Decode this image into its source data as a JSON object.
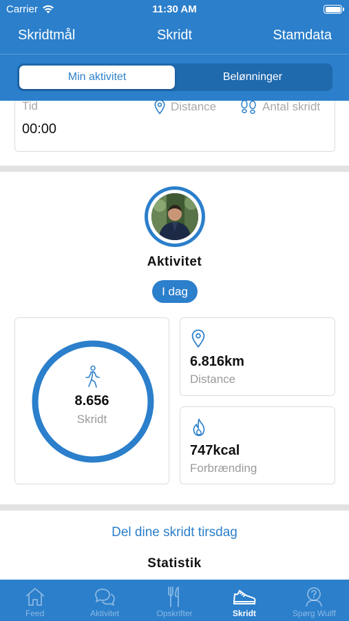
{
  "status_bar": {
    "carrier": "Carrier",
    "time": "11:30 AM"
  },
  "nav": {
    "left": "Skridtmål",
    "title": "Skridt",
    "right": "Stamdata"
  },
  "segments": [
    {
      "label": "Min aktivitet",
      "active": true
    },
    {
      "label": "Belønninger",
      "active": false
    }
  ],
  "top_card": {
    "tid_label": "Tid",
    "tid_value": "00:00",
    "distance_label": "Distance",
    "steps_label": "Antal skridt"
  },
  "activity": {
    "title": "Aktivitet",
    "period": "I dag"
  },
  "steps_box": {
    "value": "8.656",
    "label": "Skridt",
    "progress": 1.0
  },
  "distance_box": {
    "value": "6.816km",
    "label": "Distance"
  },
  "calories_box": {
    "value": "747kcal",
    "label": "Forbrænding"
  },
  "share_link": "Del dine skridt tirsdag",
  "statistics_heading": "Statistik",
  "tabs": [
    {
      "label": "Feed",
      "icon": "home-icon",
      "active": false
    },
    {
      "label": "Aktivitet",
      "icon": "chat-bubbles-icon",
      "active": false
    },
    {
      "label": "Opskrifter",
      "icon": "cutlery-icon",
      "active": false
    },
    {
      "label": "Skridt",
      "icon": "sneaker-icon",
      "active": true
    },
    {
      "label": "Spørg Wulff",
      "icon": "question-person-icon",
      "active": false
    }
  ],
  "colors": {
    "brand": "#2b7fcb",
    "brand_dark": "#1f69ad",
    "muted_text": "#9a9a9a",
    "divider": "#e2e2e2"
  }
}
